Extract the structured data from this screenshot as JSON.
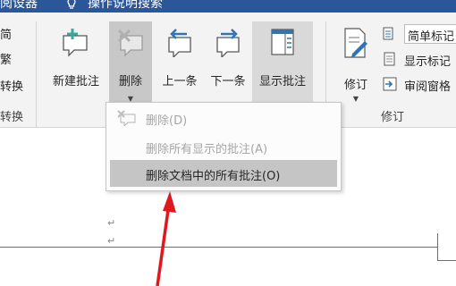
{
  "titlebar": {
    "tab_partial": "阅设器",
    "tell_me": "操作说明搜索"
  },
  "ribbon": {
    "left_partial": {
      "item1": "简",
      "item2": "繁",
      "item3": "转换",
      "group": "转换"
    },
    "comments": {
      "new_comment": "新建批注",
      "delete": "删除",
      "previous": "上一条",
      "next": "下一条",
      "show_comments": "显示批注"
    },
    "tracking": {
      "track_changes": "修订",
      "simple_markup": "简单标记",
      "show_markup": "显示标记",
      "reviewing_pane": "审阅窗格",
      "group_label": "修订"
    }
  },
  "delete_menu": {
    "items": [
      {
        "label": "删除(D)",
        "enabled": false
      },
      {
        "label": "删除所有显示的批注(A)",
        "enabled": false
      },
      {
        "label": "删除文档中的所有批注(O)",
        "enabled": true,
        "highlighted": true
      }
    ]
  },
  "document": {
    "paragraph_marks": [
      "↵",
      "↵"
    ]
  },
  "colors": {
    "title_blue": "#2b579a",
    "icon_teal": "#3aa89c",
    "icon_blue": "#2e75b6",
    "arrow_red": "#e0181e"
  }
}
